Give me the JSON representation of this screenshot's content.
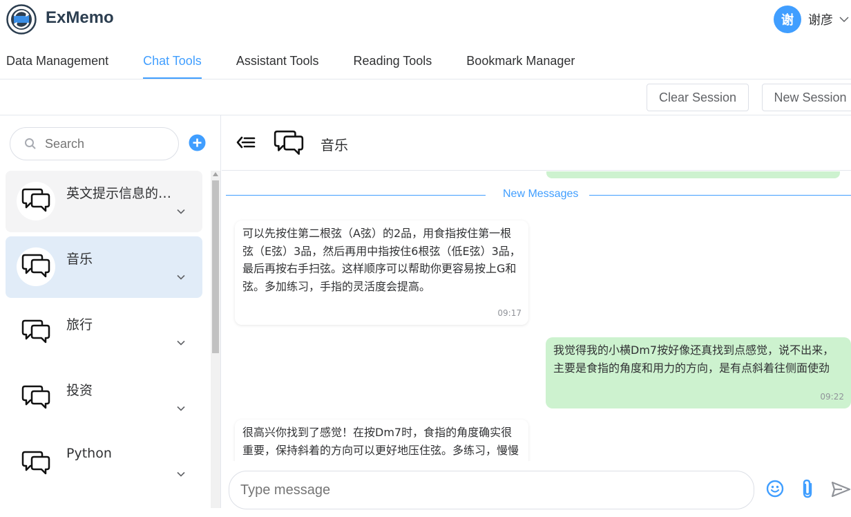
{
  "app": {
    "title": "ExMemo"
  },
  "user": {
    "avatar_char": "谢",
    "name": "谢彦"
  },
  "nav": {
    "tabs": [
      {
        "label": "Data Management",
        "active": false
      },
      {
        "label": "Chat Tools",
        "active": true
      },
      {
        "label": "Assistant Tools",
        "active": false
      },
      {
        "label": "Reading Tools",
        "active": false
      },
      {
        "label": "Bookmark Manager",
        "active": false
      }
    ]
  },
  "toolbar": {
    "clear_label": "Clear Session",
    "new_label": "New Session"
  },
  "sidebar": {
    "search_placeholder": "Search",
    "sessions": [
      {
        "title": "英文提示信息的…"
      },
      {
        "title": "音乐"
      },
      {
        "title": "旅行"
      },
      {
        "title": "投资"
      },
      {
        "title": "Python"
      }
    ]
  },
  "chat": {
    "title": "音乐",
    "divider_label": "New Messages",
    "messages": [
      {
        "from": "assistant",
        "text": "可以先按住第二根弦（A弦）的2品，用食指按住第一根弦（E弦）3品，然后再用中指按住6根弦（低E弦）3品，最后再按右手扫弦。这样顺序可以帮助你更容易按上G和弦。多加练习，手指的灵活度会提高。",
        "time": "09:17"
      },
      {
        "from": "user",
        "text": "我觉得我的小横Dm7按好像还真找到点感觉，说不出来，主要是食指的角度和用力的方向，是有点斜着往侧面使劲",
        "time": "09:22"
      },
      {
        "from": "assistant",
        "text": "很高兴你找到了感觉！在按Dm7时，食指的角度确实很重要，保持斜着的方向可以更好地压住弦。多练习，慢慢就会越来越熟练。",
        "time": ""
      }
    ],
    "input_placeholder": "Type message"
  },
  "colors": {
    "accent": "#409eff",
    "user_bubble": "#cdf2cf",
    "active_session": "#e1ecf8"
  }
}
